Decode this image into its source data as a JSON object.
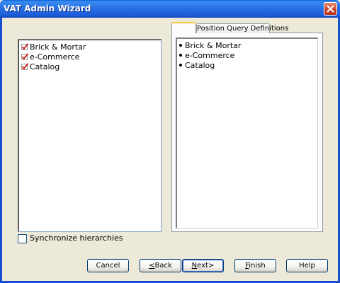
{
  "window": {
    "title": "VAT Admin Wizard",
    "close_icon": "close-icon"
  },
  "left_list": {
    "items": [
      {
        "label": "Brick & Mortar",
        "checked": true
      },
      {
        "label": "e-Commerce",
        "checked": true
      },
      {
        "label": "Catalog",
        "checked": true
      }
    ]
  },
  "tabs": [
    {
      "label": ""
    },
    {
      "label": "Position Query Definitions"
    }
  ],
  "right_list": {
    "items": [
      {
        "label": "Brick & Mortar"
      },
      {
        "label": "e-Commerce"
      },
      {
        "label": "Catalog"
      }
    ]
  },
  "sync_checkbox": {
    "label": "Synchronize hierarchies",
    "checked": false
  },
  "buttons": {
    "cancel": "Cancel",
    "back_mnemonic": "<",
    "back_rest": "Back",
    "next_mnemonic": "N",
    "next_rest": "ext>",
    "finish_mnemonic": "F",
    "finish_rest": "inish",
    "help": "Help"
  },
  "colors": {
    "titlebar": "#2a74e8",
    "dialog_bg": "#ece9d8",
    "check_mark": "#d01010",
    "tab_highlight": "#ffc83c"
  }
}
